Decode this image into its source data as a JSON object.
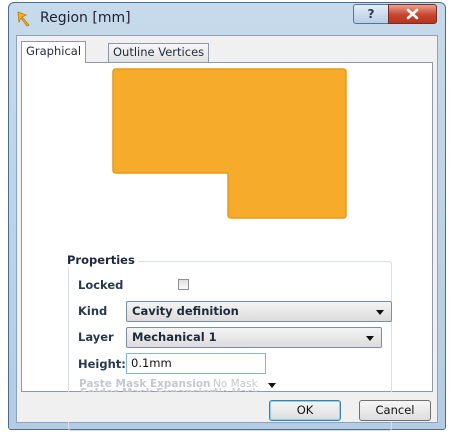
{
  "window": {
    "title": "Region [mm]",
    "help_button": "?",
    "close_button": "close"
  },
  "tabs": [
    {
      "label": "Graphical",
      "active": true
    },
    {
      "label": "Outline Vertices",
      "active": false
    }
  ],
  "preview": {
    "fill_color": "#f6ab2a",
    "stroke_color": "#e79a1a"
  },
  "properties": {
    "legend": "Properties",
    "locked": {
      "label": "Locked",
      "checked": false
    },
    "kind": {
      "label": "Kind",
      "value": "Cavity definition"
    },
    "layer": {
      "label": "Layer",
      "value": "Mechanical 1"
    },
    "height": {
      "label": "Height:",
      "value": "0.1mm"
    },
    "solder_mask": {
      "label": "Solder Mask Expansion",
      "value": "No Mask"
    },
    "paste_mask": {
      "label": "Paste Mask Expansion",
      "value": "No Mask"
    }
  },
  "buttons": {
    "ok": "OK",
    "cancel": "Cancel"
  }
}
